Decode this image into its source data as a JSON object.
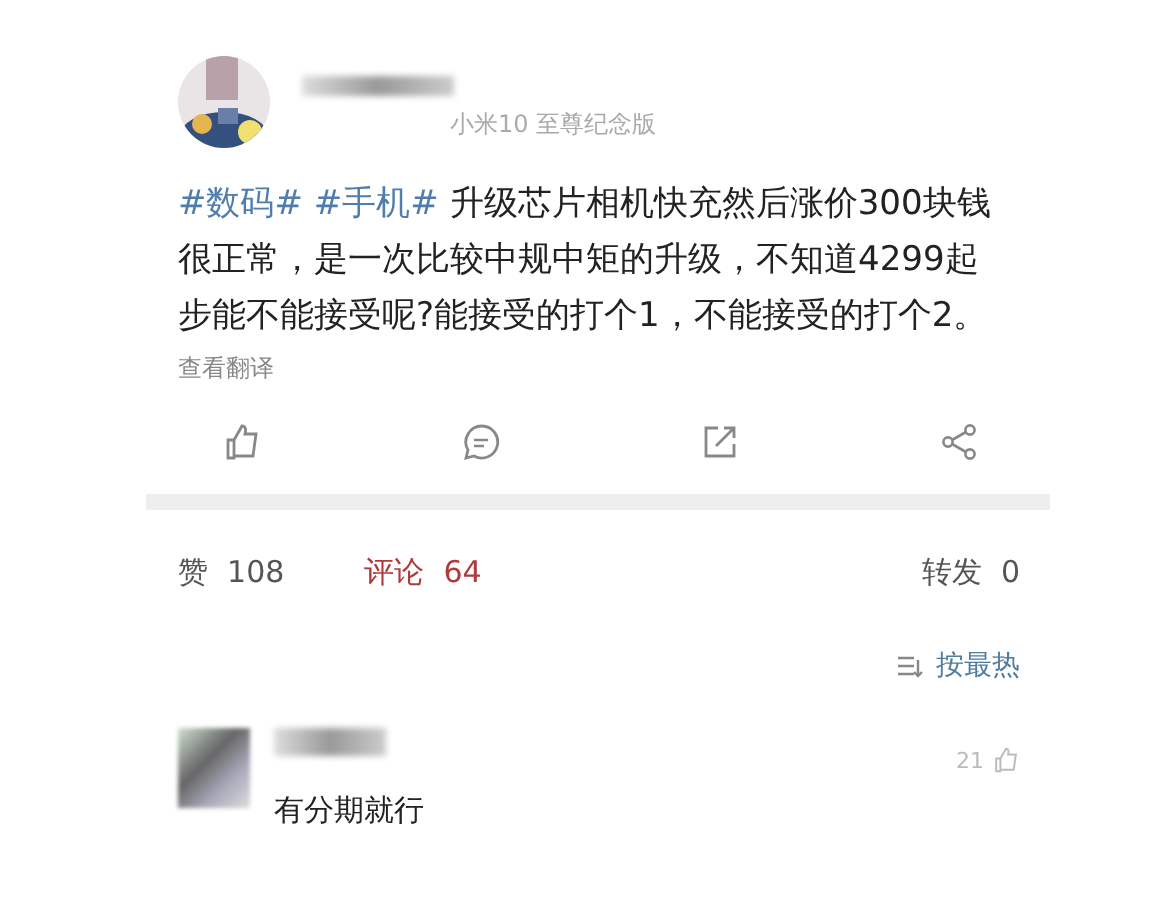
{
  "post": {
    "device": "小米10 至尊纪念版",
    "body": [
      {
        "kind": "tag",
        "text": "#数码#"
      },
      {
        "kind": "tag",
        "text": "#手机#"
      },
      {
        "kind": "text",
        "text": "升级芯片相机快充然后涨价300块钱很正常，是一次比较中规中矩的升级，不知道4299起步能不能接受呢?能接受的打个1，不能接受的打个2。"
      }
    ],
    "translate": "查看翻译"
  },
  "stats": [
    {
      "label": "赞",
      "count": "108",
      "selected": false
    },
    {
      "label": "评论",
      "count": "64",
      "selected": true
    },
    {
      "label": "转发",
      "count": "0",
      "selected": false
    }
  ],
  "sort": "按最热",
  "comment": {
    "likes": "21",
    "text": "有分期就行"
  }
}
